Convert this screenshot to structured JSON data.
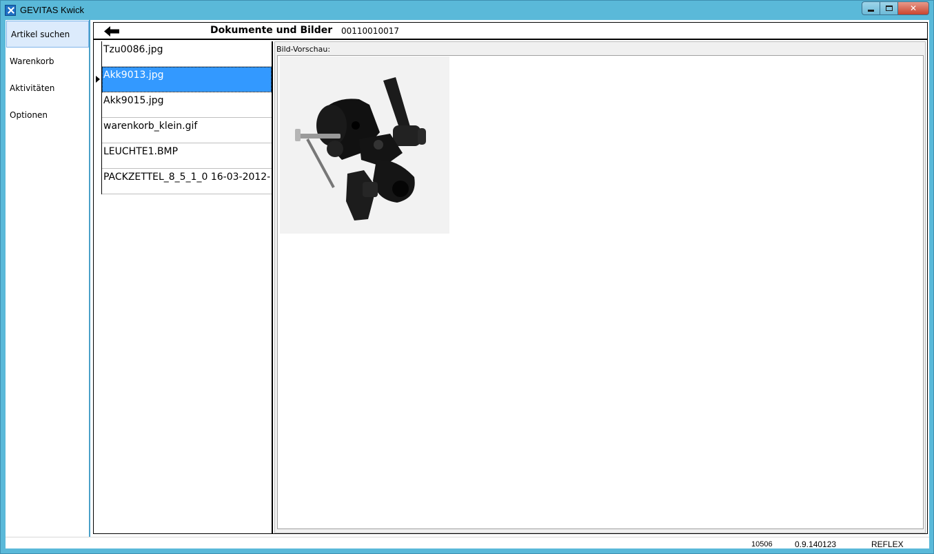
{
  "window": {
    "title": "GEVITAS Kwick",
    "app_icon": "gevitas-x-icon"
  },
  "nav": {
    "items": [
      {
        "label": "Artikel suchen",
        "active": true
      },
      {
        "label": "Warenkorb"
      },
      {
        "label": "Aktivitäten"
      },
      {
        "label": "Optionen"
      }
    ]
  },
  "header": {
    "back_icon": "arrow-left-icon",
    "title": "Dokumente und Bilder",
    "article_number": "00110010017"
  },
  "files": [
    {
      "name": "Tzu0086.jpg"
    },
    {
      "name": "Akk9013.jpg",
      "selected": true
    },
    {
      "name": "Akk9015.jpg"
    },
    {
      "name": "warenkorb_klein.gif"
    },
    {
      "name": "LEUCHTE1.BMP"
    },
    {
      "name": "PACKZETTEL_8_5_1_0 16-03-2012-"
    }
  ],
  "preview": {
    "label": "Bild-Vorschau:"
  },
  "status": {
    "left": "10506",
    "version": "0.9.140123",
    "db": "REFLEX"
  },
  "colors": {
    "frame": "#5ab9d9",
    "selection": "#3399ff",
    "nav_active_bg": "#dcebfc",
    "nav_active_border": "#7eb4ea"
  }
}
